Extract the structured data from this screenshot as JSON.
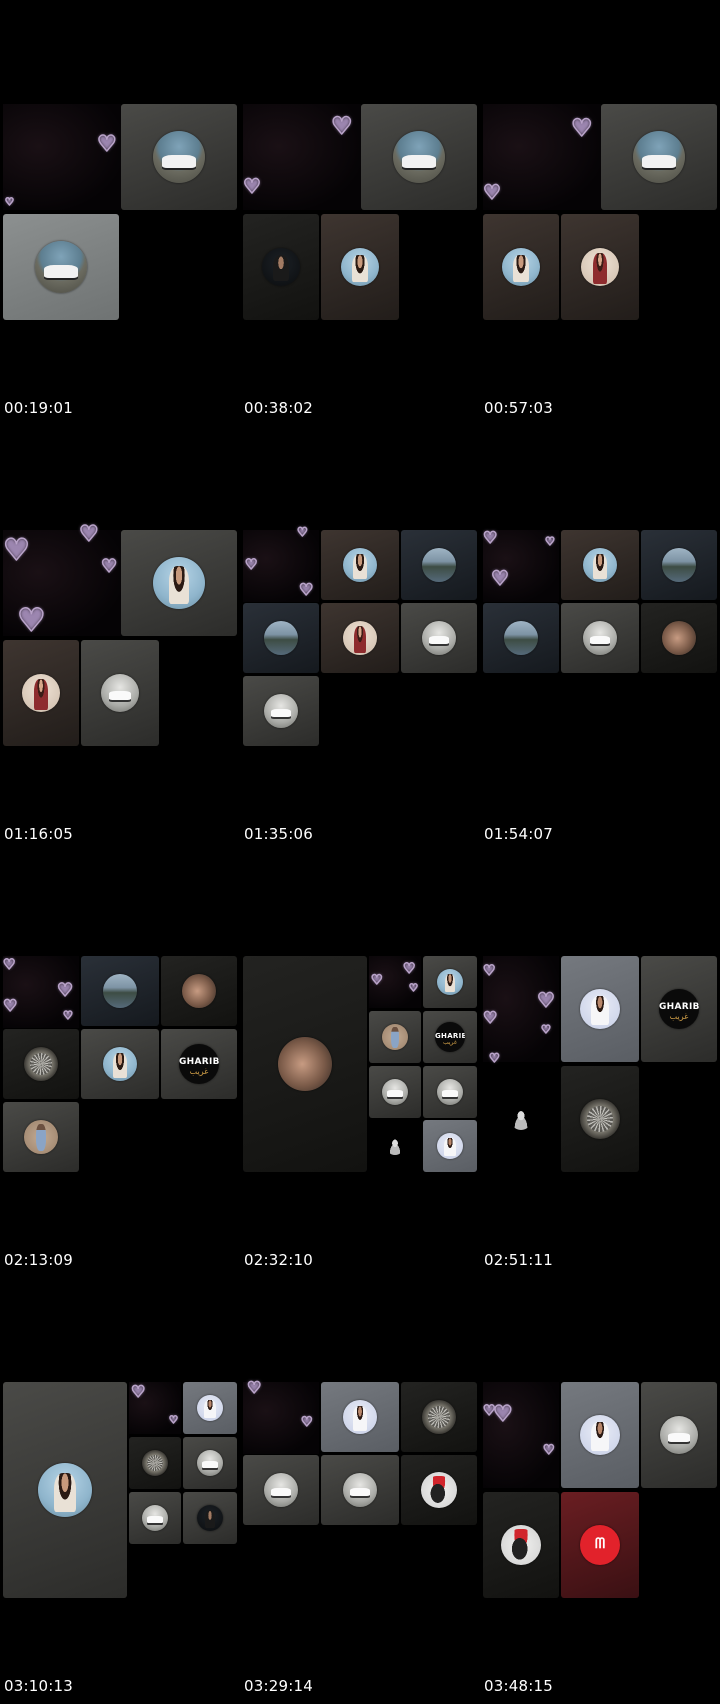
{
  "timestamps": {
    "f1": "00:19:01",
    "f2": "00:38:02",
    "f3": "00:57:03",
    "f4": "01:16:05",
    "f5": "01:35:06",
    "f6": "01:54:07",
    "f7": "02:13:09",
    "f8": "02:32:10",
    "f9": "02:51:11",
    "f10": "03:10:13",
    "f11": "03:29:14",
    "f12": "03:48:15"
  },
  "logo": {
    "gharib_latin": "GHARIB",
    "gharib_arabic": "غريب"
  },
  "icons": {
    "heart": "heart-outline-icon",
    "avatar": "circular-profile-image"
  },
  "colors": {
    "background": "#000000",
    "heart_stroke": "#b9a3c9",
    "gharib_gold": "#d7a44a",
    "red_logo": "#e2222b"
  }
}
